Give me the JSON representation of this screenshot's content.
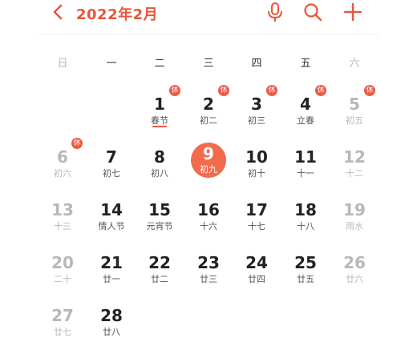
{
  "header": {
    "title": "2022年2月"
  },
  "weekdays": [
    "日",
    "一",
    "二",
    "三",
    "四",
    "五",
    "六"
  ],
  "days": [
    {
      "num": "1",
      "lunar": "春节",
      "rest": "休"
    },
    {
      "num": "2",
      "lunar": "初二",
      "rest": "休"
    },
    {
      "num": "3",
      "lunar": "初三",
      "rest": "休"
    },
    {
      "num": "4",
      "lunar": "立春",
      "rest": "休"
    },
    {
      "num": "5",
      "lunar": "初五",
      "rest": "休"
    },
    {
      "num": "6",
      "lunar": "初六",
      "rest": "休"
    },
    {
      "num": "7",
      "lunar": "初七"
    },
    {
      "num": "8",
      "lunar": "初八"
    },
    {
      "num": "9",
      "lunar": "初九"
    },
    {
      "num": "10",
      "lunar": "初十"
    },
    {
      "num": "11",
      "lunar": "十一"
    },
    {
      "num": "12",
      "lunar": "十二"
    },
    {
      "num": "13",
      "lunar": "十三"
    },
    {
      "num": "14",
      "lunar": "情人节"
    },
    {
      "num": "15",
      "lunar": "元宵节"
    },
    {
      "num": "16",
      "lunar": "十六"
    },
    {
      "num": "17",
      "lunar": "十七"
    },
    {
      "num": "18",
      "lunar": "十八"
    },
    {
      "num": "19",
      "lunar": "雨水"
    },
    {
      "num": "20",
      "lunar": "二十"
    },
    {
      "num": "21",
      "lunar": "廿一"
    },
    {
      "num": "22",
      "lunar": "廿二"
    },
    {
      "num": "23",
      "lunar": "廿三"
    },
    {
      "num": "24",
      "lunar": "廿四"
    },
    {
      "num": "25",
      "lunar": "廿五"
    },
    {
      "num": "26",
      "lunar": "廿六"
    },
    {
      "num": "27",
      "lunar": "廿七"
    },
    {
      "num": "28",
      "lunar": "廿八"
    }
  ],
  "colors": {
    "accent": "#ef5a45",
    "today": "#f26b4c",
    "weekend_text": "#b8b8b8"
  }
}
